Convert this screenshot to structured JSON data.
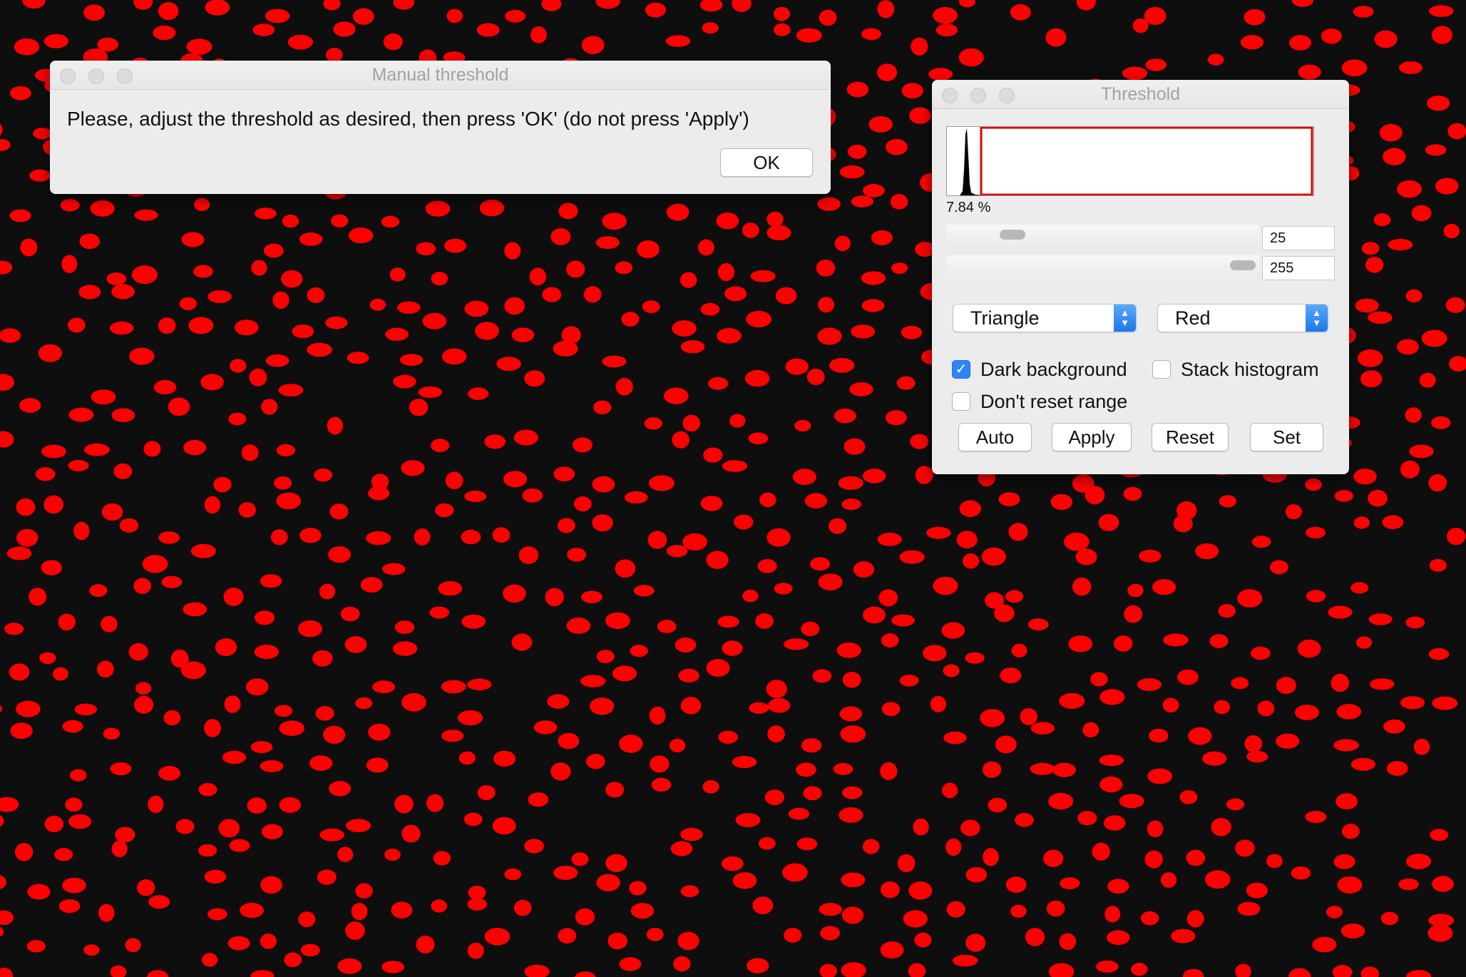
{
  "manual_dialog": {
    "title": "Manual threshold",
    "message": "Please, adjust the threshold as desired, then press 'OK' (do not press 'Apply')",
    "ok_label": "OK"
  },
  "threshold_dialog": {
    "title": "Threshold",
    "percent_label": "7.84 %",
    "lower_value": "25",
    "upper_value": "255",
    "lower_slider_fraction": 0.098,
    "upper_slider_fraction": 1.0,
    "method": "Triangle",
    "display_color": "Red",
    "dark_background": {
      "label": "Dark background",
      "checked": true
    },
    "stack_histogram": {
      "label": "Stack histogram",
      "checked": false
    },
    "dont_reset_range": {
      "label": "Don't reset range",
      "checked": false
    },
    "buttons": {
      "auto": "Auto",
      "apply": "Apply",
      "reset": "Reset",
      "set": "Set"
    }
  },
  "colors": {
    "threshold_overlay": "#ff0000",
    "image_background": "#0e0e0e",
    "checkbox_accent": "#2f86f6"
  }
}
